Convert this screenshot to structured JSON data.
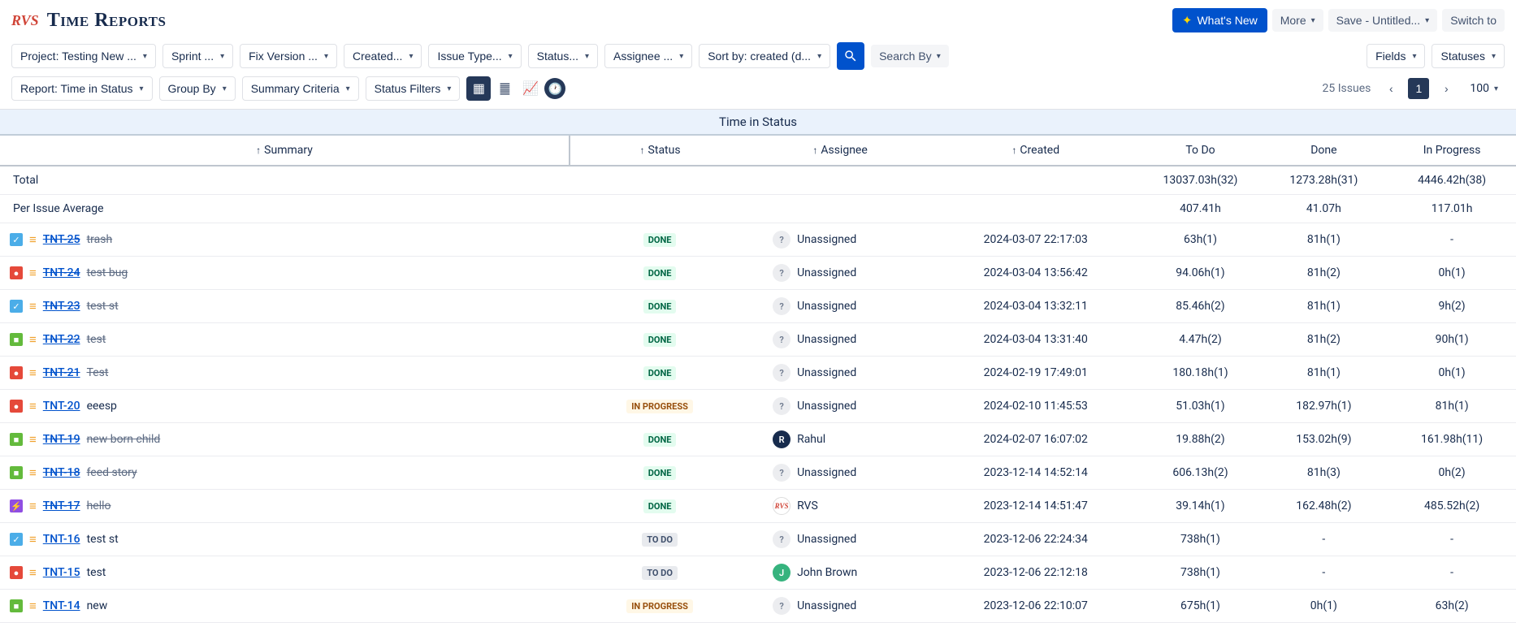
{
  "header": {
    "logo_prefix": "RVS",
    "title": "Time Reports",
    "whats_new": "What's New",
    "more": "More",
    "save": "Save - Untitled...",
    "switch": "Switch to"
  },
  "filters_row1": {
    "project": "Project: Testing New ...",
    "sprint": "Sprint ...",
    "fix_version": "Fix Version ...",
    "created": "Created...",
    "issue_type": "Issue Type...",
    "status": "Status...",
    "assignee": "Assignee ...",
    "sort_by": "Sort by: created (d...",
    "search_by": "Search By",
    "fields": "Fields",
    "statuses": "Statuses"
  },
  "filters_row2": {
    "report": "Report: Time in Status",
    "group_by": "Group By",
    "summary_criteria": "Summary Criteria",
    "status_filters": "Status Filters",
    "issue_count": "25 Issues",
    "page": "1",
    "page_size": "100"
  },
  "table_title": "Time in Status",
  "columns": {
    "summary": "Summary",
    "status": "Status",
    "assignee": "Assignee",
    "created": "Created",
    "todo": "To Do",
    "done": "Done",
    "in_progress": "In Progress"
  },
  "summary_rows": {
    "total_label": "Total",
    "total_todo": "13037.03h(32)",
    "total_done": "1273.28h(31)",
    "total_prog": "4446.42h(38)",
    "avg_label": "Per Issue Average",
    "avg_todo": "407.41h",
    "avg_done": "41.07h",
    "avg_prog": "117.01h"
  },
  "status_labels": {
    "done": "DONE",
    "in_progress": "IN PROGRESS",
    "todo": "TO DO"
  },
  "issues": [
    {
      "key": "TNT-25",
      "title": "trash",
      "type": "task",
      "status": "done",
      "done": true,
      "assignee": "Unassigned",
      "av": "unassigned",
      "created": "2024-03-07 22:17:03",
      "todo": "63h(1)",
      "d": "81h(1)",
      "prog": "-"
    },
    {
      "key": "TNT-24",
      "title": "test bug",
      "type": "bug",
      "status": "done",
      "done": true,
      "assignee": "Unassigned",
      "av": "unassigned",
      "created": "2024-03-04 13:56:42",
      "todo": "94.06h(1)",
      "d": "81h(2)",
      "prog": "0h(1)"
    },
    {
      "key": "TNT-23",
      "title": "test st",
      "type": "task",
      "status": "done",
      "done": true,
      "assignee": "Unassigned",
      "av": "unassigned",
      "created": "2024-03-04 13:32:11",
      "todo": "85.46h(2)",
      "d": "81h(1)",
      "prog": "9h(2)"
    },
    {
      "key": "TNT-22",
      "title": "test",
      "type": "story",
      "status": "done",
      "done": true,
      "assignee": "Unassigned",
      "av": "unassigned",
      "created": "2024-03-04 13:31:40",
      "todo": "4.47h(2)",
      "d": "81h(2)",
      "prog": "90h(1)"
    },
    {
      "key": "TNT-21",
      "title": "Test",
      "type": "bug",
      "status": "done",
      "done": true,
      "assignee": "Unassigned",
      "av": "unassigned",
      "created": "2024-02-19 17:49:01",
      "todo": "180.18h(1)",
      "d": "81h(1)",
      "prog": "0h(1)"
    },
    {
      "key": "TNT-20",
      "title": "eeesp",
      "type": "bug",
      "status": "in_progress",
      "done": false,
      "assignee": "Unassigned",
      "av": "unassigned",
      "created": "2024-02-10 11:45:53",
      "todo": "51.03h(1)",
      "d": "182.97h(1)",
      "prog": "81h(1)"
    },
    {
      "key": "TNT-19",
      "title": "new born child",
      "type": "story",
      "status": "done",
      "done": true,
      "assignee": "Rahul",
      "av": "user1",
      "created": "2024-02-07 16:07:02",
      "todo": "19.88h(2)",
      "d": "153.02h(9)",
      "prog": "161.98h(11)"
    },
    {
      "key": "TNT-18",
      "title": "feed story",
      "type": "story",
      "status": "done",
      "done": true,
      "assignee": "Unassigned",
      "av": "unassigned",
      "created": "2023-12-14 14:52:14",
      "todo": "606.13h(2)",
      "d": "81h(3)",
      "prog": "0h(2)"
    },
    {
      "key": "TNT-17",
      "title": "hello",
      "type": "epic",
      "status": "done",
      "done": true,
      "assignee": "RVS",
      "av": "rvs",
      "created": "2023-12-14 14:51:47",
      "todo": "39.14h(1)",
      "d": "162.48h(2)",
      "prog": "485.52h(2)"
    },
    {
      "key": "TNT-16",
      "title": "test st",
      "type": "task",
      "status": "todo",
      "done": false,
      "assignee": "Unassigned",
      "av": "unassigned",
      "created": "2023-12-06 22:24:34",
      "todo": "738h(1)",
      "d": "-",
      "prog": "-"
    },
    {
      "key": "TNT-15",
      "title": "test",
      "type": "bug",
      "status": "todo",
      "done": false,
      "assignee": "John Brown",
      "av": "user2",
      "created": "2023-12-06 22:12:18",
      "todo": "738h(1)",
      "d": "-",
      "prog": "-"
    },
    {
      "key": "TNT-14",
      "title": "new",
      "type": "story",
      "status": "in_progress",
      "done": false,
      "assignee": "Unassigned",
      "av": "unassigned",
      "created": "2023-12-06 22:10:07",
      "todo": "675h(1)",
      "d": "0h(1)",
      "prog": "63h(2)"
    }
  ]
}
